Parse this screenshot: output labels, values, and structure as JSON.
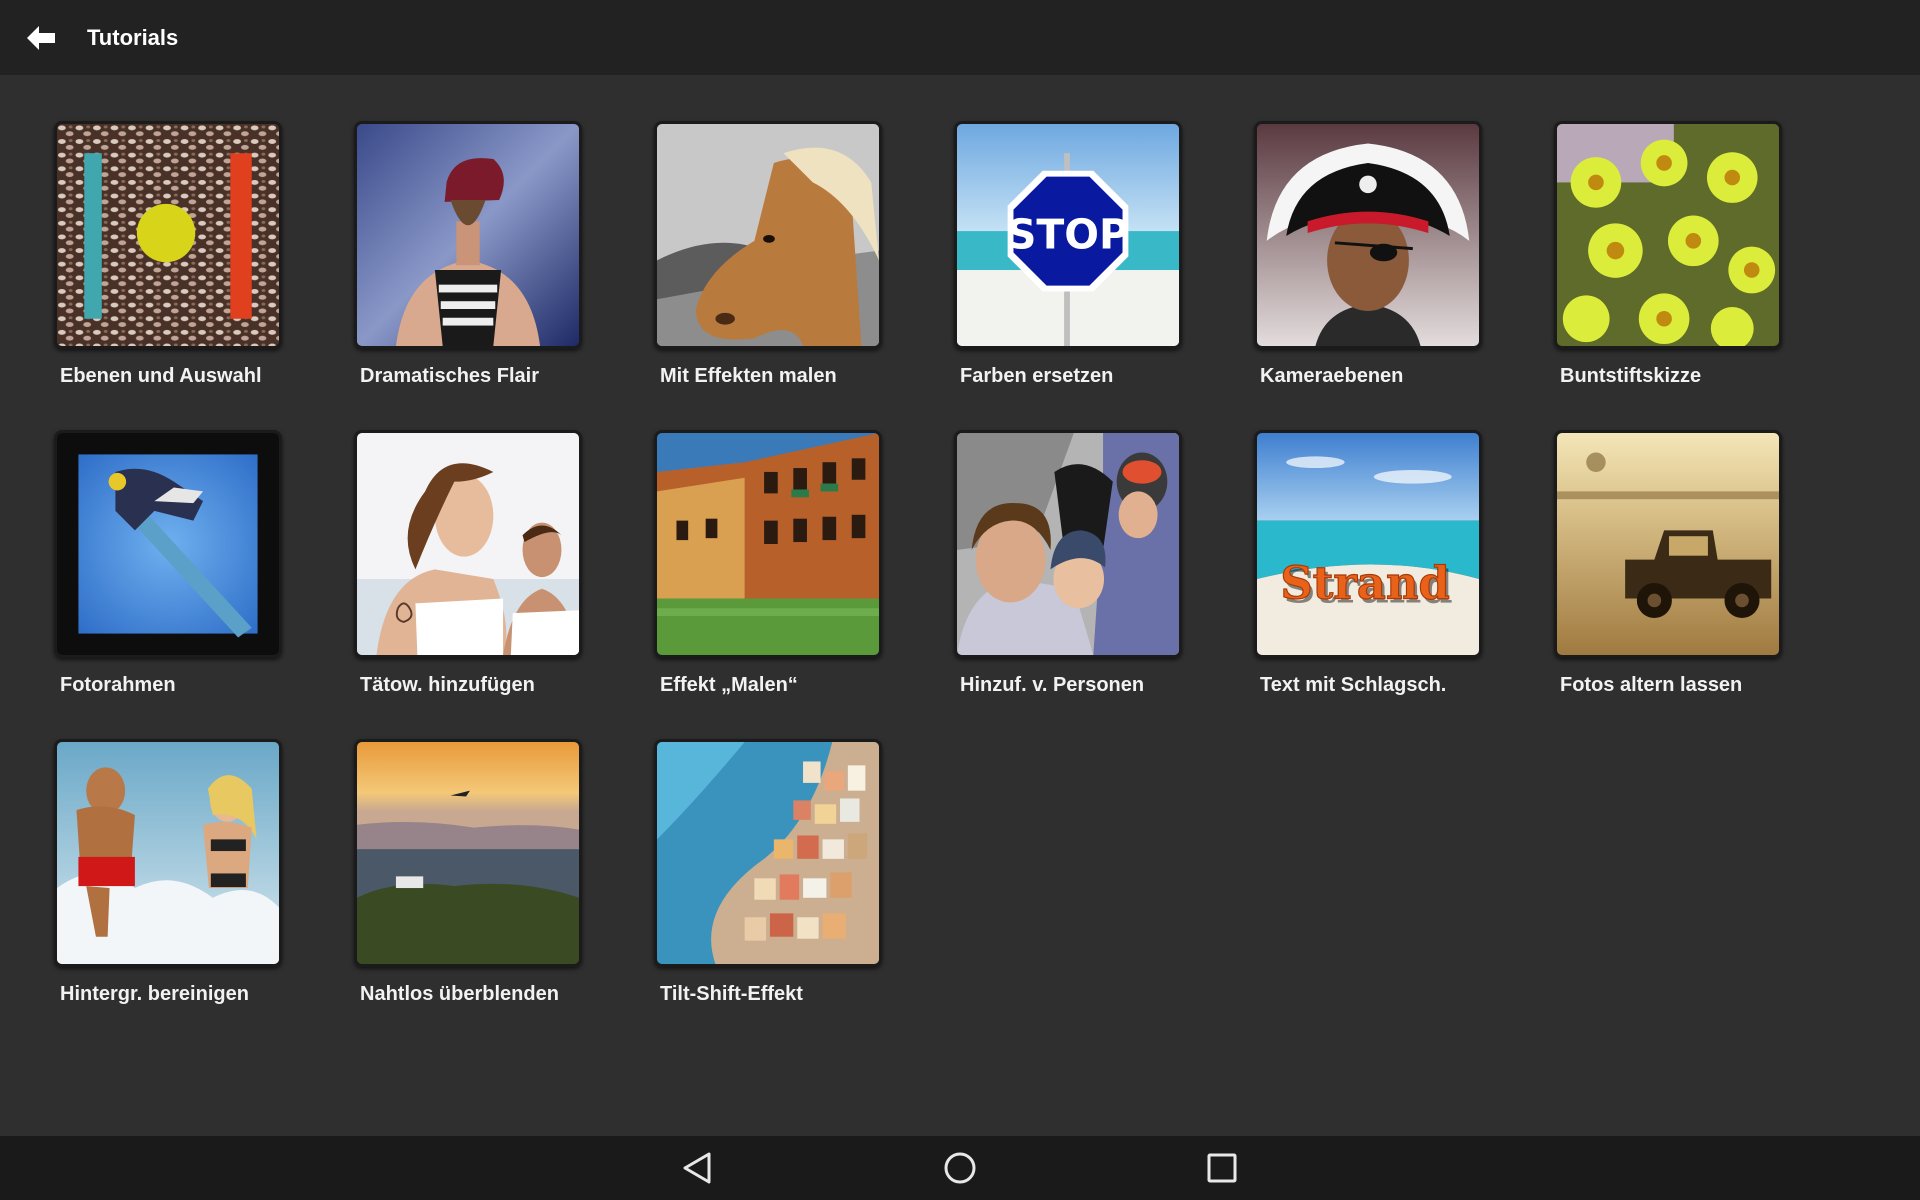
{
  "header": {
    "title": "Tutorials",
    "back_icon": "back-arrow-icon"
  },
  "tutorials": [
    {
      "label": "Ebenen und Auswahl"
    },
    {
      "label": "Dramatisches Flair"
    },
    {
      "label": "Mit Effekten malen"
    },
    {
      "label": "Farben ersetzen",
      "sign_text": "STOP"
    },
    {
      "label": "Kameraebenen"
    },
    {
      "label": "Buntstiftskizze"
    },
    {
      "label": "Fotorahmen"
    },
    {
      "label": "Tätow. hinzufügen"
    },
    {
      "label": "Effekt „Malen“"
    },
    {
      "label": "Hinzuf. v. Personen"
    },
    {
      "label": "Text mit Schlagsch.",
      "overlay_text": "Strand"
    },
    {
      "label": "Fotos altern lassen"
    },
    {
      "label": "Hintergr. bereinigen"
    },
    {
      "label": "Nahtlos überblenden"
    },
    {
      "label": "Tilt-Shift-Effekt"
    }
  ],
  "navbar": {
    "back_icon": "nav-back-triangle-icon",
    "home_icon": "nav-home-circle-icon",
    "recents_icon": "nav-recents-square-icon"
  },
  "colors": {
    "topbar": "#222222",
    "background": "#2f2f2f",
    "navbar": "#1a1a1a"
  }
}
